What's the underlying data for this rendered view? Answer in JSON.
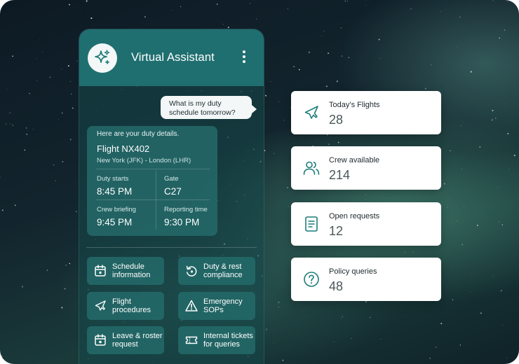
{
  "colors": {
    "accent": "#1f6f70",
    "icon_teal": "#1e7c7a",
    "card_bg": "#ffffff"
  },
  "assistant": {
    "title": "Virtual Assistant",
    "logo_icon": "sparkle-icon",
    "menu_icon": "more-vertical-icon",
    "user_message": "What is my duty schedule tomorrow?",
    "details": {
      "intro": "Here are your duty details.",
      "flight": "Flight NX402",
      "route": "New York (JFK) - London (LHR)",
      "fields": [
        {
          "label": "Duty starts",
          "value": "8:45 PM"
        },
        {
          "label": "Gate",
          "value": "C27"
        },
        {
          "label": "Crew briefing",
          "value": "9:45 PM"
        },
        {
          "label": "Reporting time",
          "value": "9:30 PM"
        }
      ]
    },
    "quick_actions": [
      {
        "label": "Schedule\ninformation",
        "icon": "calendar-icon"
      },
      {
        "label": "Duty & rest\ncompliance",
        "icon": "rotate-icon"
      },
      {
        "label": "Flight\nprocedures",
        "icon": "plane-icon"
      },
      {
        "label": "Emergency\nSOPs",
        "icon": "warning-icon"
      },
      {
        "label": "Leave & roster\nrequest",
        "icon": "calendar-request-icon"
      },
      {
        "label": "Internal tickets\nfor queries",
        "icon": "ticket-icon"
      }
    ]
  },
  "stats": [
    {
      "label": "Today’s Flights",
      "value": "28",
      "icon": "plane-icon"
    },
    {
      "label": "Crew available",
      "value": "214",
      "icon": "users-icon"
    },
    {
      "label": "Open requests",
      "value": "12",
      "icon": "document-icon"
    },
    {
      "label": "Policy queries",
      "value": "48",
      "icon": "question-icon"
    }
  ]
}
